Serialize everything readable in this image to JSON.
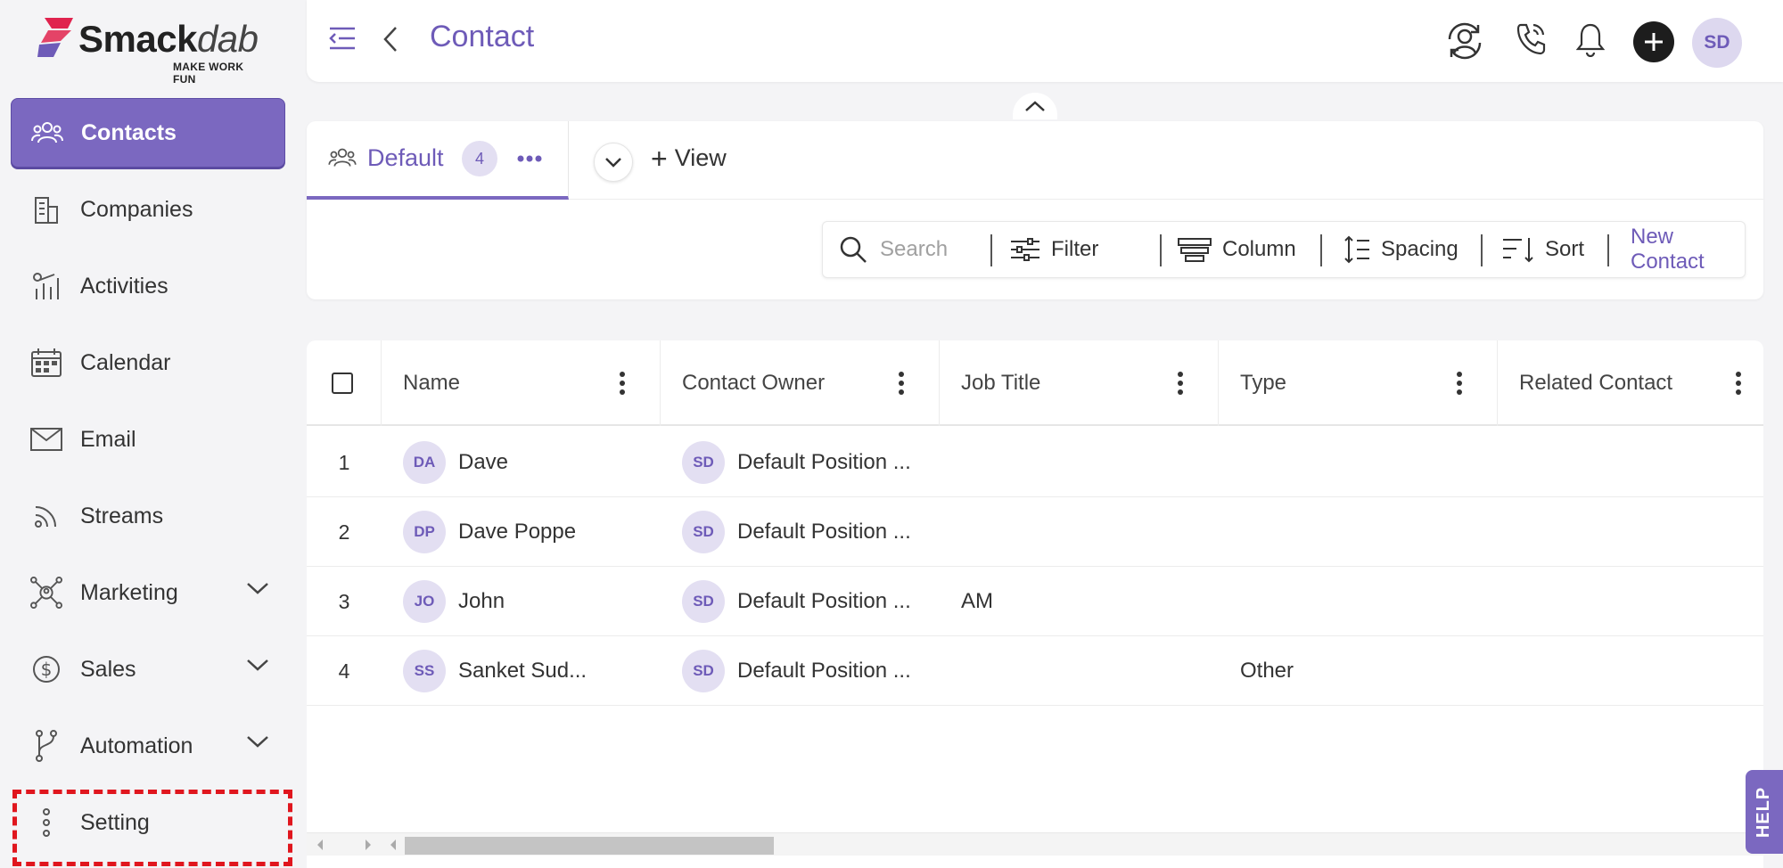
{
  "brand": {
    "name_bold": "Smack",
    "name_italic": "dab",
    "tagline": "MAKE WORK FUN",
    "accent_color": "#7b68c0",
    "logo_color": "#e0234e"
  },
  "sidebar": {
    "items": [
      {
        "label": "Contacts",
        "icon": "contacts-icon",
        "active": true
      },
      {
        "label": "Companies",
        "icon": "building-icon"
      },
      {
        "label": "Activities",
        "icon": "activities-icon"
      },
      {
        "label": "Calendar",
        "icon": "calendar-icon"
      },
      {
        "label": "Email",
        "icon": "envelope-icon"
      },
      {
        "label": "Streams",
        "icon": "rss-icon"
      },
      {
        "label": "Marketing",
        "icon": "network-icon",
        "expandable": true
      },
      {
        "label": "Sales",
        "icon": "dollar-icon",
        "expandable": true
      },
      {
        "label": "Automation",
        "icon": "branch-icon",
        "expandable": true
      },
      {
        "label": "Setting",
        "icon": "vertical-dots-icon",
        "highlighted": true
      }
    ]
  },
  "header": {
    "title": "Contact",
    "user_initials": "SD"
  },
  "views": {
    "default_label": "Default",
    "default_count": "4",
    "add_view_label": "View"
  },
  "toolbar": {
    "search_placeholder": "Search",
    "filter_label": "Filter",
    "column_label": "Column",
    "spacing_label": "Spacing",
    "sort_label": "Sort",
    "new_contact_label": "New Contact"
  },
  "table": {
    "columns": [
      "Name",
      "Contact Owner",
      "Job Title",
      "Type",
      "Related Contact"
    ],
    "rows": [
      {
        "num": "1",
        "initials": "DA",
        "name": "Dave",
        "owner_initials": "SD",
        "owner": "Default Position ...",
        "job_title": "",
        "type": ""
      },
      {
        "num": "2",
        "initials": "DP",
        "name": "Dave Poppe",
        "owner_initials": "SD",
        "owner": "Default Position ...",
        "job_title": "",
        "type": ""
      },
      {
        "num": "3",
        "initials": "JO",
        "name": "John",
        "owner_initials": "SD",
        "owner": "Default Position ...",
        "job_title": "AM",
        "type": ""
      },
      {
        "num": "4",
        "initials": "SS",
        "name": "Sanket Sud...",
        "owner_initials": "SD",
        "owner": "Default Position ...",
        "job_title": "",
        "type": "Other"
      }
    ]
  },
  "help": {
    "label": "HELP"
  }
}
